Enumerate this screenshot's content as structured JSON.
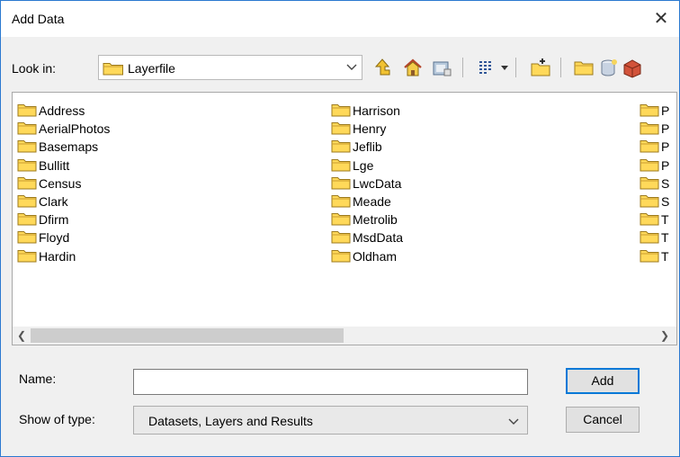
{
  "dialog": {
    "title": "Add Data",
    "close_glyph": "✕"
  },
  "lookin": {
    "label": "Look in:",
    "value": "Layerfile"
  },
  "toolbar": {
    "icons": [
      "up-one-level-icon",
      "home-icon",
      "connect-folder-icon",
      "view-list-icon",
      "view-dropdown-icon",
      "new-folder-icon",
      "catalog-folder-icon",
      "database-icon",
      "toolbox-icon"
    ]
  },
  "files": {
    "col1": [
      "Address",
      "AerialPhotos",
      "Basemaps",
      "Bullitt",
      "Census",
      "Clark",
      "Dfirm",
      "Floyd",
      "Hardin"
    ],
    "col2": [
      "Harrison",
      "Henry",
      "Jeflib",
      "Lge",
      "LwcData",
      "Meade",
      "Metrolib",
      "MsdData",
      "Oldham"
    ],
    "col3": [
      "P",
      "P",
      "P",
      "P",
      "S",
      "S",
      "T",
      "T",
      "T"
    ]
  },
  "name": {
    "label": "Name:",
    "value": ""
  },
  "type": {
    "label": "Show of type:",
    "value": "Datasets, Layers and Results"
  },
  "buttons": {
    "add": "Add",
    "cancel": "Cancel"
  },
  "colors": {
    "accent": "#0078d7",
    "folder": "#ffd95a"
  }
}
